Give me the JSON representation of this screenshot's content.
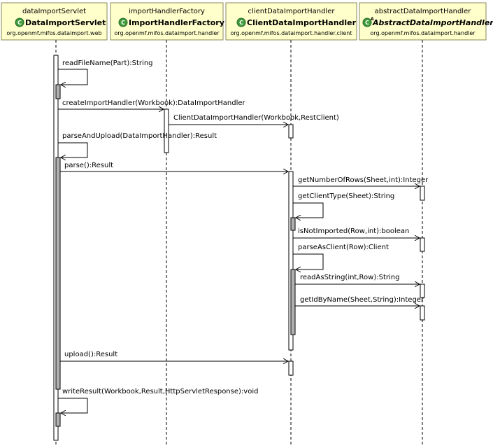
{
  "participants": [
    {
      "id": "servlet",
      "instance": "dataImportServlet",
      "class": "DataImportServlet",
      "package": "org.openmf.mifos.dataimport.web",
      "abstract": false
    },
    {
      "id": "factory",
      "instance": "importHandlerFactory",
      "class": "ImportHandlerFactory",
      "package": "org.openmf.mifos.dataimport.handler",
      "abstract": false
    },
    {
      "id": "client",
      "instance": "clientDataImportHandler",
      "class": "ClientDataImportHandler",
      "package": "org.openmf.mifos.dataimport.handler.client",
      "abstract": false
    },
    {
      "id": "abstract",
      "instance": "abstractDataImportHandler",
      "class": "AbstractDataImportHandler",
      "package": "org.openmf.mifos.dataimport.handler",
      "abstract": true
    }
  ],
  "messages": [
    {
      "label": "readFileName(Part):String",
      "from": "servlet",
      "to": "servlet",
      "self": true
    },
    {
      "label": "createImportHandler(Workbook):DataImportHandler",
      "from": "servlet",
      "to": "factory"
    },
    {
      "label": "ClientDataImportHandler(Workbook,RestClient)",
      "from": "factory",
      "to": "client"
    },
    {
      "label": "parseAndUpload(DataImportHandler):Result",
      "from": "servlet",
      "to": "servlet",
      "self": true
    },
    {
      "label": "parse():Result",
      "from": "servlet",
      "to": "client"
    },
    {
      "label": "getNumberOfRows(Sheet,int):Integer",
      "from": "client",
      "to": "abstract"
    },
    {
      "label": "getClientType(Sheet):String",
      "from": "client",
      "to": "client",
      "self": true
    },
    {
      "label": "isNotImported(Row,int):boolean",
      "from": "client",
      "to": "abstract"
    },
    {
      "label": "parseAsClient(Row):Client",
      "from": "client",
      "to": "client",
      "self": true
    },
    {
      "label": "readAsString(int,Row):String",
      "from": "client",
      "to": "abstract"
    },
    {
      "label": "getIdByName(Sheet,String):Integer",
      "from": "client",
      "to": "abstract"
    },
    {
      "label": "upload():Result",
      "from": "servlet",
      "to": "client"
    },
    {
      "label": "writeResult(Workbook,Result,HttpServletResponse):void",
      "from": "servlet",
      "to": "servlet",
      "self": true
    }
  ],
  "colors": {
    "header_fill": "#ffffcc",
    "header_border": "#8a8a5a",
    "class_icon": "#3e9a3a",
    "activation_shade": "#b0b0b0",
    "line": "#000000"
  },
  "icons": {
    "class": "class-c-icon",
    "abstract_class": "abstract-class-a-icon"
  }
}
